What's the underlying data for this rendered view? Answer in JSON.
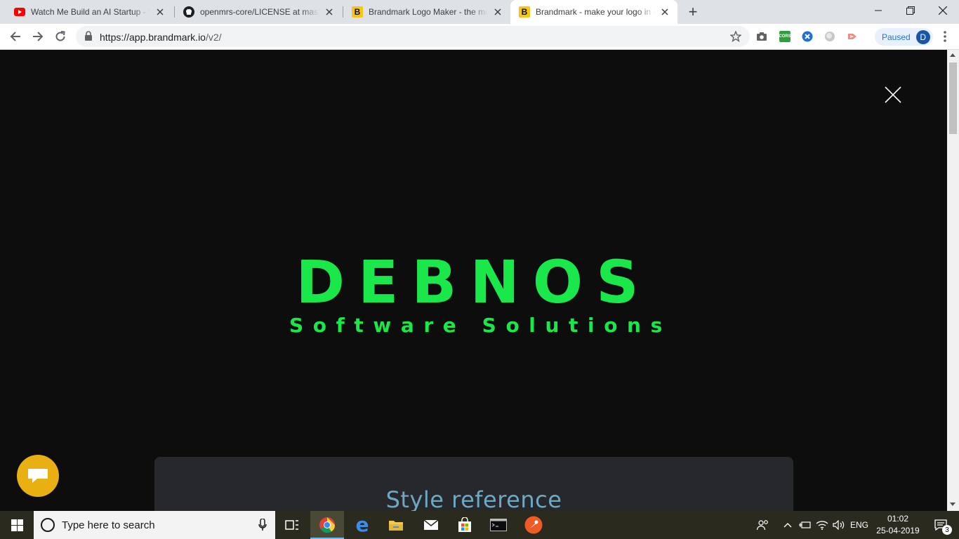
{
  "browser": {
    "tabs": [
      {
        "title": "Watch Me Build an AI Startup - Yo",
        "icon": "youtube-icon"
      },
      {
        "title": "openmrs-core/LICENSE at master",
        "icon": "github-icon"
      },
      {
        "title": "Brandmark Logo Maker - the mo",
        "icon": "brandmark-icon",
        "fav_letter": "B"
      },
      {
        "title": "Brandmark - make your logo in m",
        "icon": "brandmark-icon",
        "fav_letter": "B",
        "active": true
      }
    ],
    "new_tab": "+",
    "address": {
      "host": "https://app.brandmark.io",
      "path": "/v2/"
    },
    "profile": {
      "status": "Paused",
      "avatar_letter": "D"
    },
    "extensions": [
      "camera-icon",
      "cors-icon",
      "xmind-icon",
      "circle-icon",
      "cast-icon"
    ],
    "cors_label": "CORS"
  },
  "page": {
    "logo": {
      "name": "DEBNOS",
      "tagline": "Software Solutions",
      "color": "#19e74a"
    },
    "style_reference": "Style reference",
    "background": "#0d0d0d"
  },
  "taskbar": {
    "search_placeholder": "Type here to search",
    "pinned": [
      "task-view-icon",
      "chrome-icon",
      "edge-icon",
      "file-explorer-icon",
      "mail-icon",
      "store-icon",
      "terminal-icon",
      "postman-icon"
    ],
    "language": "ENG",
    "time": "01:02",
    "date": "25-04-2019",
    "notification_count": "3"
  }
}
